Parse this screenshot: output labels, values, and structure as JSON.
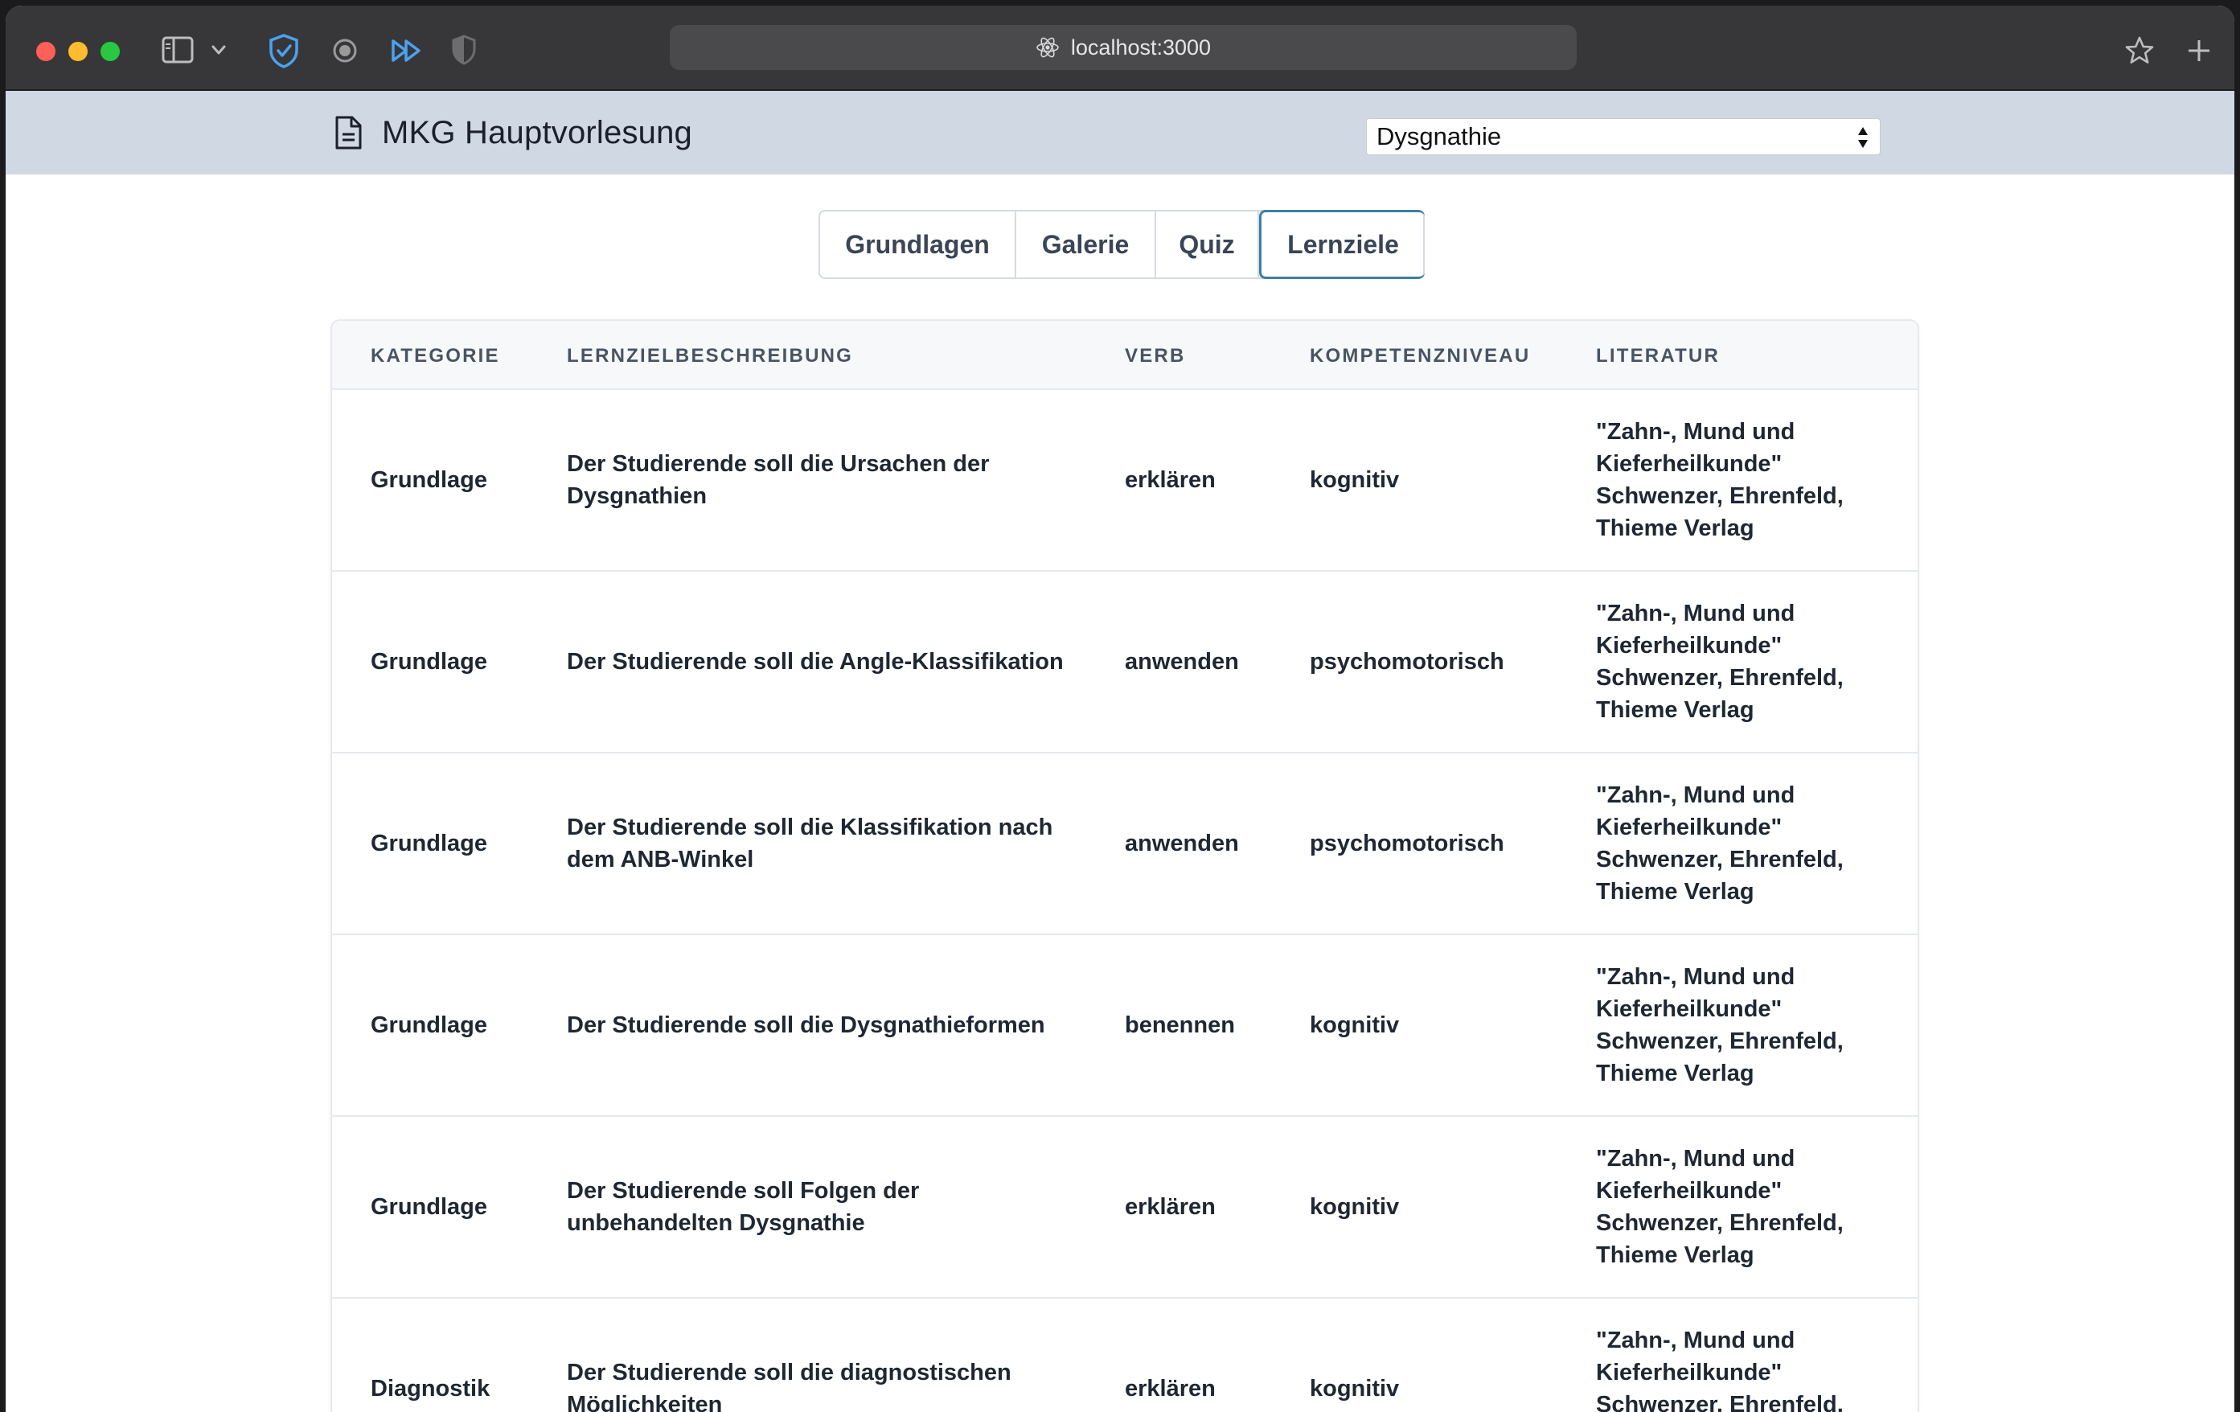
{
  "browser": {
    "address": "localhost:3000"
  },
  "header": {
    "title": "MKG Hauptvorlesung",
    "topic_selected": "Dysgnathie"
  },
  "tabs": [
    {
      "label": "Grundlagen",
      "active": false
    },
    {
      "label": "Galerie",
      "active": false
    },
    {
      "label": "Quiz",
      "active": false
    },
    {
      "label": "Lernziele",
      "active": true
    }
  ],
  "table": {
    "columns": [
      "KATEGORIE",
      "LERNZIELBESCHREIBUNG",
      "VERB",
      "KOMPETENZNIVEAU",
      "LITERATUR"
    ],
    "rows": [
      {
        "kategorie": "Grundlage",
        "beschreibung": "Der Studierende soll die Ursachen der Dysgnathien",
        "verb": "erklären",
        "kompetenz": "kognitiv",
        "literatur": "\"Zahn-, Mund und Kieferheilkunde\" Schwenzer, Ehrenfeld, Thieme Verlag"
      },
      {
        "kategorie": "Grundlage",
        "beschreibung": "Der Studierende soll die Angle-Klassifikation",
        "verb": "anwenden",
        "kompetenz": "psychomotorisch",
        "literatur": "\"Zahn-, Mund und Kieferheilkunde\" Schwenzer, Ehrenfeld, Thieme Verlag"
      },
      {
        "kategorie": "Grundlage",
        "beschreibung": "Der Studierende soll die Klassifikation nach dem ANB-Winkel",
        "verb": "anwenden",
        "kompetenz": "psychomotorisch",
        "literatur": "\"Zahn-, Mund und Kieferheilkunde\" Schwenzer, Ehrenfeld, Thieme Verlag"
      },
      {
        "kategorie": "Grundlage",
        "beschreibung": "Der Studierende soll die Dysgnathieformen",
        "verb": "benennen",
        "kompetenz": "kognitiv",
        "literatur": "\"Zahn-, Mund und Kieferheilkunde\" Schwenzer, Ehrenfeld, Thieme Verlag"
      },
      {
        "kategorie": "Grundlage",
        "beschreibung": "Der Studierende soll Folgen der unbehandelten Dysgnathie",
        "verb": "erklären",
        "kompetenz": "kognitiv",
        "literatur": "\"Zahn-, Mund und Kieferheilkunde\" Schwenzer, Ehrenfeld, Thieme Verlag"
      },
      {
        "kategorie": "Diagnostik",
        "beschreibung": "Der Studierende soll die diagnostischen Möglichkeiten",
        "verb": "erklären",
        "kompetenz": "kognitiv",
        "literatur": "\"Zahn-, Mund und Kieferheilkunde\" Schwenzer, Ehrenfeld, Thieme Verlag"
      }
    ]
  }
}
